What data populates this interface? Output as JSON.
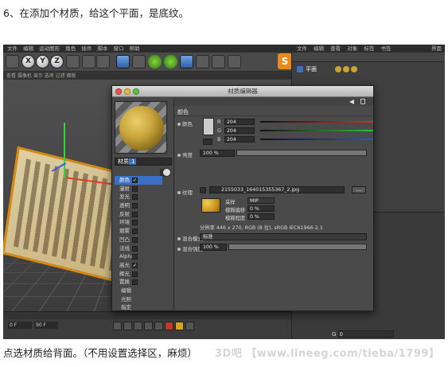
{
  "caption_top": "6、在添加个材质，给这个平面，是底纹。",
  "caption_bottom": "点选材质给背面。（不用设置选择区，麻烦）",
  "watermark": "3D吧 【www.lineeg.com/tieba/1799】",
  "c4d": {
    "menu": [
      "文件",
      "编辑",
      "运动图形",
      "角色",
      "插件",
      "脚本",
      "窗口",
      "帮助"
    ],
    "toolbar_axes": [
      "X",
      "Y",
      "Z"
    ],
    "right_tabs": [
      "文件",
      "编辑",
      "查看",
      "对象",
      "标签",
      "书签"
    ],
    "object_name": "平面",
    "layout_label": "界面",
    "attr_field_label": "G",
    "attr_field_value": "0",
    "viewport_header": "查看  摄像机  显示  选项  过滤  面板",
    "timeline_frames": [
      "0 F",
      "90 F"
    ],
    "accent": "#e98a1a"
  },
  "material_editor": {
    "title": "材质编辑器",
    "material_name_prefix": "材质",
    "material_name_selected": ".1",
    "section_title": "颜色",
    "color_label": "颜色",
    "rgb": [
      {
        "label": "R",
        "value": "204",
        "color": "#d03030"
      },
      {
        "label": "G",
        "value": "204",
        "color": "#30c030"
      },
      {
        "label": "B",
        "value": "204",
        "color": "#3050d0"
      }
    ],
    "brightness_label": "亮度",
    "brightness_value": "100 %",
    "texture_label": "纹理",
    "texture_file": "2155033_164015355367_2.jpg",
    "texture_more": "...",
    "sampling_label": "采样",
    "sampling_value": "MIP",
    "blur_offset_label": "模糊偏移",
    "blur_offset_value": "0 %",
    "blur_scale_label": "模糊程度",
    "blur_scale_value": "0 %",
    "resolution_info": "分辨率 446 x 270, RGB (8 位), sRGB IEC61966-2.1",
    "blend_mode_label": "混合模式",
    "blend_mode_value": "标准",
    "blend_strength_label": "混合强度",
    "blend_strength_value": "100 %",
    "channels": [
      {
        "name": "颜色",
        "checked": true,
        "active": true
      },
      {
        "name": "漫射",
        "checked": false,
        "active": false
      },
      {
        "name": "发光",
        "checked": false,
        "active": false
      },
      {
        "name": "透明",
        "checked": false,
        "active": false
      },
      {
        "name": "反射",
        "checked": false,
        "active": false
      },
      {
        "name": "环境",
        "checked": false,
        "active": false
      },
      {
        "name": "烟雾",
        "checked": false,
        "active": false
      },
      {
        "name": "凹凸",
        "checked": false,
        "active": false
      },
      {
        "name": "法线",
        "checked": false,
        "active": false
      },
      {
        "name": "Alpha",
        "checked": false,
        "active": false
      },
      {
        "name": "高光",
        "checked": true,
        "active": false
      },
      {
        "name": "辉光",
        "checked": false,
        "active": false
      },
      {
        "name": "置换",
        "checked": false,
        "active": false
      }
    ],
    "extra_items": [
      "编辑",
      "光照",
      "指定"
    ]
  }
}
